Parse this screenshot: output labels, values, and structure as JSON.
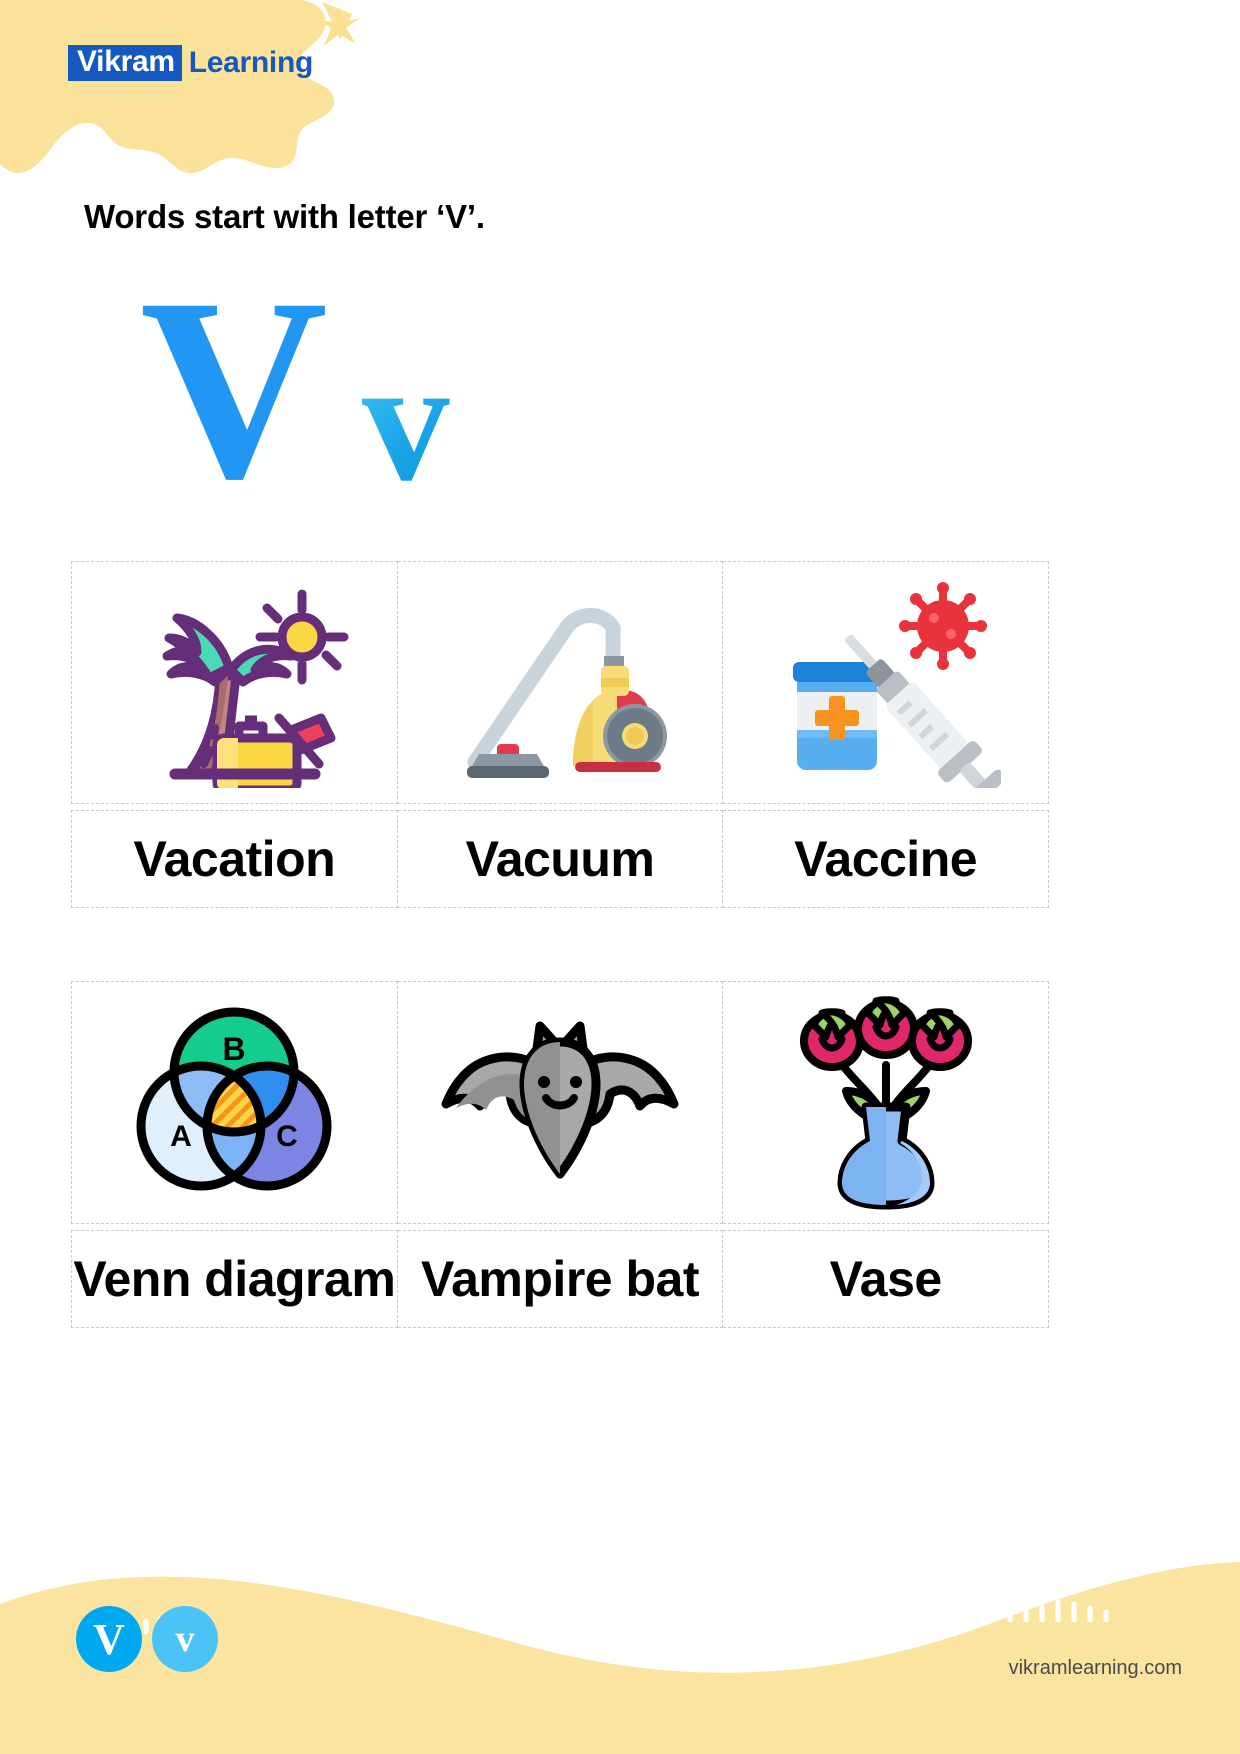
{
  "header": {
    "logo_primary": "Vikram",
    "logo_secondary": "Learning",
    "brand_blue": "#1559c0",
    "blob_yellow": "#fae29a"
  },
  "title": "Words start with letter ‘V’.",
  "letter_showcase": {
    "uppercase": "V",
    "lowercase": "v",
    "uppercase_color": "#2196f3",
    "lowercase_gradient_start": "#41c6f5",
    "lowercase_gradient_end": "#0f9ade"
  },
  "rows": [
    {
      "cells": [
        {
          "word": "Vacation",
          "icon": "palm-tree-suitcase-sun-icon"
        },
        {
          "word": "Vacuum",
          "icon": "vacuum-cleaner-icon"
        },
        {
          "word": "Vaccine",
          "icon": "syringe-vial-virus-icon"
        }
      ]
    },
    {
      "cells": [
        {
          "word": "Venn diagram",
          "icon": "venn-diagram-icon"
        },
        {
          "word": "Vampire bat",
          "icon": "bat-icon"
        },
        {
          "word": "Vase",
          "icon": "flower-vase-icon"
        }
      ]
    }
  ],
  "venn_labels": {
    "a": "A",
    "b": "B",
    "c": "C"
  },
  "footer": {
    "badge_upper": "V",
    "badge_lower": "v",
    "website": "vikramlearning.com",
    "wave_color": "#fbe3a0",
    "badge_upper_color": "#00a8f0",
    "badge_lower_color": "#4cc3f7"
  }
}
